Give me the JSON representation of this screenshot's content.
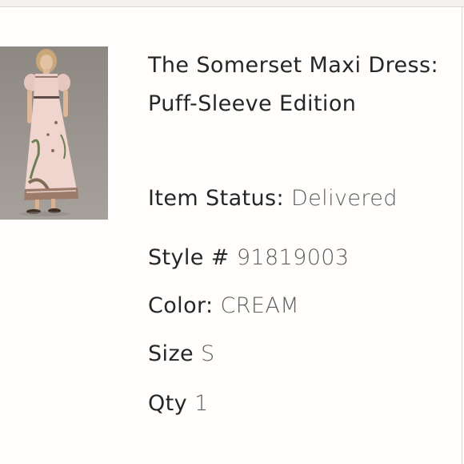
{
  "product": {
    "image": {
      "icon": "product-photo-dress",
      "alt": ""
    },
    "title": "The Somerset Maxi Dress: Puff-Sleeve Edition",
    "status": {
      "label": "Item Status:",
      "value": "Delivered"
    },
    "style": {
      "label": "Style #",
      "value": "91819003"
    },
    "color": {
      "label": "Color:",
      "value": "CREAM"
    },
    "size": {
      "label": "Size",
      "value": "S"
    },
    "qty": {
      "label": "Qty",
      "value": "1"
    }
  },
  "colors": {
    "text": "#262626",
    "value_text": "#5e5e5e",
    "background": "#fffefc"
  }
}
